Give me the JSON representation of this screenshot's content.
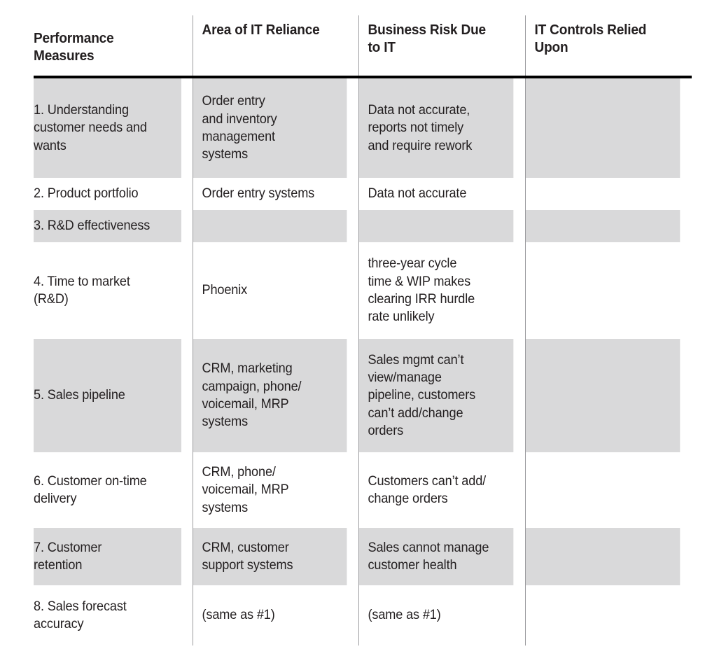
{
  "table": {
    "columns": [
      {
        "key": "performance_measures",
        "label": "Performance\nMeasures"
      },
      {
        "key": "area_of_it_reliance",
        "label": "Area of IT Reliance"
      },
      {
        "key": "business_risk_due_to_it",
        "label": "Business Risk Due\nto IT"
      },
      {
        "key": "it_controls_relied_upon",
        "label": "IT Controls Relied\nUpon"
      }
    ],
    "rows": [
      {
        "shaded": true,
        "performance_measures": "1. Understanding\ncustomer needs and\nwants",
        "area_of_it_reliance": "Order entry\nand inventory\nmanagement\nsystems",
        "business_risk_due_to_it": "Data not accurate,\nreports not timely\nand require rework",
        "it_controls_relied_upon": ""
      },
      {
        "shaded": false,
        "performance_measures": "2. Product portfolio",
        "area_of_it_reliance": "Order entry systems",
        "business_risk_due_to_it": "Data not accurate",
        "it_controls_relied_upon": ""
      },
      {
        "shaded": true,
        "performance_measures": "3. R&D effectiveness",
        "area_of_it_reliance": "",
        "business_risk_due_to_it": "",
        "it_controls_relied_upon": ""
      },
      {
        "shaded": false,
        "performance_measures": "4. Time to market\n(R&D)",
        "area_of_it_reliance": "Phoenix",
        "business_risk_due_to_it": "three-year cycle\ntime & WIP makes\nclearing IRR hurdle\nrate unlikely",
        "it_controls_relied_upon": ""
      },
      {
        "shaded": true,
        "performance_measures": "5. Sales pipeline",
        "area_of_it_reliance": "CRM, marketing\ncampaign, phone/\nvoicemail, MRP\nsystems",
        "business_risk_due_to_it": "Sales mgmt can’t\nview/manage\npipeline, customers\ncan’t add/change\norders",
        "it_controls_relied_upon": ""
      },
      {
        "shaded": false,
        "performance_measures": "6. Customer on-time\ndelivery",
        "area_of_it_reliance": "CRM, phone/\nvoicemail, MRP\nsystems",
        "business_risk_due_to_it": "Customers can’t add/\nchange orders",
        "it_controls_relied_upon": ""
      },
      {
        "shaded": true,
        "performance_measures": "7. Customer\nretention",
        "area_of_it_reliance": "CRM, customer\nsupport systems",
        "business_risk_due_to_it": "Sales cannot manage\ncustomer health",
        "it_controls_relied_upon": ""
      },
      {
        "shaded": false,
        "performance_measures": "8. Sales forecast\naccuracy",
        "area_of_it_reliance": "(same as #1)",
        "business_risk_due_to_it": "(same as #1)",
        "it_controls_relied_upon": ""
      }
    ]
  },
  "style": {
    "shaded_row_color": "#d9d9da",
    "plain_row_color": "#ffffff",
    "text_color": "#231f20",
    "divider_color": "#9b9b9e",
    "header_rule_color": "#000000"
  }
}
